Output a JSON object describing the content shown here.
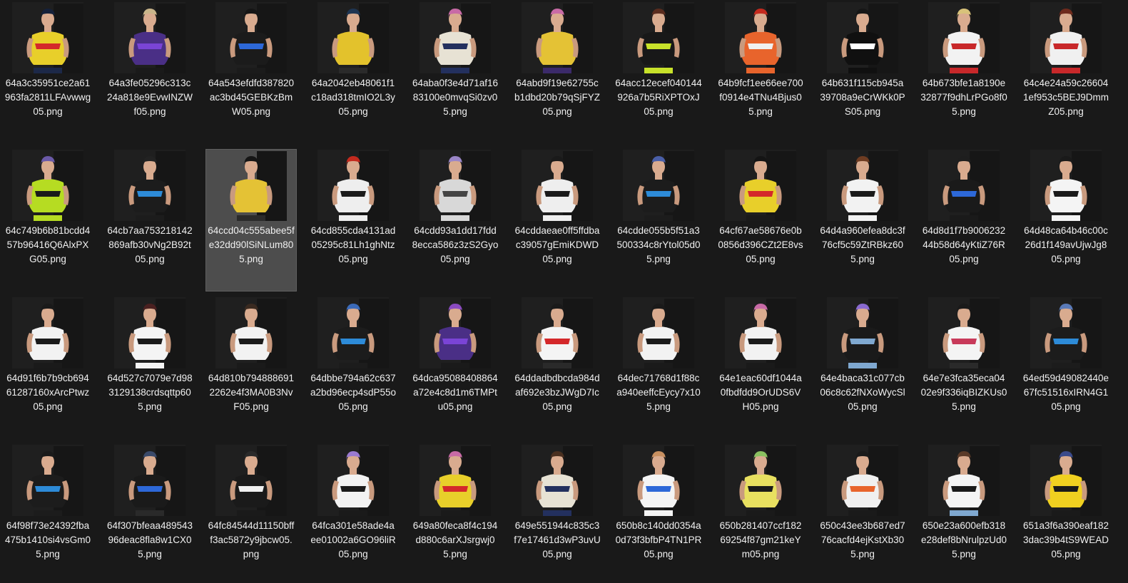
{
  "window": {
    "view": "large-icons",
    "background": "#191919"
  },
  "selected_index": 13,
  "files": [
    {
      "name": "64a3c35951ce2a61963fa2811LFAvwwg05.png",
      "hair": "#15213a",
      "top": "#e8cf2a",
      "accent": "#d4282a",
      "bottom": "#1c2848"
    },
    {
      "name": "64a3fe05296c313c24a818e9EvwINZWf05.png",
      "hair": "#c9b58a",
      "top": "#4a2f86",
      "accent": "#7a44d6",
      "bottom": "#1a1a1a"
    },
    {
      "name": "64a543efdfd387820ac3bd45GEBKzBmW05.png",
      "hair": "#151515",
      "top": "#1b1b1b",
      "accent": "#2d68d8",
      "bottom": "#1b1b1b"
    },
    {
      "name": "64a2042eb48061f1c18ad318tmIO2L3y05.png",
      "hair": "#1e3552",
      "top": "#e3c22c",
      "accent": "#e3c22c",
      "bottom": "#2a2a2a"
    },
    {
      "name": "64aba0f3e4d71af1683100e0mvqSi0zv05.png",
      "hair": "#c86aa6",
      "top": "#e7e2d4",
      "accent": "#23305e",
      "bottom": "#23305e"
    },
    {
      "name": "64abd9f19e62755cb1dbd20b79qSjFYZ05.png",
      "hair": "#c86aa6",
      "top": "#e4c235",
      "accent": "#e4c235",
      "bottom": "#3b2a6a"
    },
    {
      "name": "64acc12ecef040144926a7b5RiXPTOxJ05.png",
      "hair": "#5a2c1e",
      "top": "#181818",
      "accent": "#c8e22a",
      "bottom": "#c8e22a"
    },
    {
      "name": "64b9fcf1ee66ee700f0914e4TNu4Bjus05.png",
      "hair": "#c42a1e",
      "top": "#e8642c",
      "accent": "#f0f0f0",
      "bottom": "#e8642c"
    },
    {
      "name": "64b631f115cb945a39708a9eCrWKk0PS05.png",
      "hair": "#161616",
      "top": "#101010",
      "accent": "#ffffff",
      "bottom": "#101010"
    },
    {
      "name": "64b673bfe1a8190e32877f9dhLrPGo8f05.png",
      "hair": "#d8c27a",
      "top": "#f2f2f2",
      "accent": "#c8282a",
      "bottom": "#c8282a"
    },
    {
      "name": "64c4e24a59c266041ef953c5BEJ9DmmZ05.png",
      "hair": "#6e2a1c",
      "top": "#f0f0f0",
      "accent": "#c8282a",
      "bottom": "#c8282a"
    },
    {
      "name": "64c749b6b81bcdd457b96416Q6AlxPXG05.png",
      "hair": "#6b5aa8",
      "top": "#b6dc22",
      "accent": "#1a1a1a",
      "bottom": "#b6dc22"
    },
    {
      "name": "64cb7aa753218142869afb30vNg2B92t05.png",
      "hair": "#222222",
      "top": "#1c1c1c",
      "accent": "#2d8bd8",
      "bottom": "#1c1c1c"
    },
    {
      "name": "64ccd04c555abee5fe32dd90lSiNLum805.png",
      "hair": "#161616",
      "top": "#e4c235",
      "accent": "#e4c235",
      "bottom": "#2a2a2a"
    },
    {
      "name": "64cd855cda4131ad05295c81Lh1ghNtz05.png",
      "hair": "#c42a1e",
      "top": "#eeeeee",
      "accent": "#1a1a1a",
      "bottom": "#eeeeee"
    },
    {
      "name": "64cdd93a1dd17fdd8ecca586z3zS2Gyo05.png",
      "hair": "#9b86c8",
      "top": "#d8d8d8",
      "accent": "#444444",
      "bottom": "#d8d8d8"
    },
    {
      "name": "64cddaeae0ff5ffdbac39057gEmiKDWD05.png",
      "hair": "#1a1a1a",
      "top": "#eeeeee",
      "accent": "#1a1a1a",
      "bottom": "#eeeeee"
    },
    {
      "name": "64cdde055b5f51a3500334c8rYtol05d05.png",
      "hair": "#4a5fa8",
      "top": "#1c1c1c",
      "accent": "#2d8bd8",
      "bottom": "#1c1c1c"
    },
    {
      "name": "64cf67ae58676e0b0856d396CZt2E8vs05.png",
      "hair": "#141414",
      "top": "#e8cf2a",
      "accent": "#d4282a",
      "bottom": "#1a1a1a"
    },
    {
      "name": "64d4a960efea8dc3f76cf5c59ZtRBkz605.png",
      "hair": "#6e3c22",
      "top": "#f2f2f2",
      "accent": "#1a1a1a",
      "bottom": "#f2f2f2"
    },
    {
      "name": "64d8d1f7b900623244b58d64yKtiZ76R05.png",
      "hair": "#1e1e1e",
      "top": "#1a1a1a",
      "accent": "#2d68d8",
      "bottom": "#1a1a1a"
    },
    {
      "name": "64d48ca64b46c00c26d1f149avUjwJg805.png",
      "hair": "#1a1a1a",
      "top": "#f4f4f4",
      "accent": "#1a1a1a",
      "bottom": "#f4f4f4"
    },
    {
      "name": "64d91f6b7b9cb69461287160xArcPtwz05.png",
      "hair": "#1a1a1a",
      "top": "#f2f2f2",
      "accent": "#1a1a1a",
      "bottom": "#1a1a1a"
    },
    {
      "name": "64d527c7079e7d983129138crdsqttp605.png",
      "hair": "#4a2020",
      "top": "#f4f4f4",
      "accent": "#1a1a1a",
      "bottom": "#f4f4f4"
    },
    {
      "name": "64d810b7948886912262e4f3MA0B3NvF05.png",
      "hair": "#3a2a20",
      "top": "#f2f2f2",
      "accent": "#1a1a1a",
      "bottom": "#1a1a1a"
    },
    {
      "name": "64dbbe794a62c637a2bd96ecp4sdP55o05.png",
      "hair": "#3b6ab8",
      "top": "#1c1c1c",
      "accent": "#2d8bd8",
      "bottom": "#1c1c1c"
    },
    {
      "name": "64dca95088408864a72e4c8d1m6TMPtu05.png",
      "hair": "#8a4ac0",
      "top": "#4a2f86",
      "accent": "#7a44d6",
      "bottom": "#1a1a1a"
    },
    {
      "name": "64ddadbdbcda984daf692e3bzJWgD7Ic05.png",
      "hair": "#1a1a1a",
      "top": "#f4f4f4",
      "accent": "#d4282a",
      "bottom": "#2a2a2a"
    },
    {
      "name": "64dec71768d1f88ca940eeffcEycy7x105.png",
      "hair": "#1a1a1a",
      "top": "#f2f2f2",
      "accent": "#1a1a1a",
      "bottom": "#1a1a1a"
    },
    {
      "name": "64e1eac60df1044a0fbdfdd9OrUDS6VH05.png",
      "hair": "#c86aa6",
      "top": "#f2f2f2",
      "accent": "#1a1a1a",
      "bottom": "#1a1a1a"
    },
    {
      "name": "64e4baca31c077cb06c8c62fNXoWycSl05.png",
      "hair": "#8a6ad0",
      "top": "#1a1a1a",
      "accent": "#7fa8d0",
      "bottom": "#7fa8d0"
    },
    {
      "name": "64e7e3fca35eca0402e9f336iqBIZKUs05.png",
      "hair": "#1a1a1a",
      "top": "#f4f4f4",
      "accent": "#c83a5a",
      "bottom": "#2a2a2a"
    },
    {
      "name": "64ed59d49082440e67fc51516xIRN4G105.png",
      "hair": "#5a7ab8",
      "top": "#1c1c1c",
      "accent": "#2d8bd8",
      "bottom": "#1c1c1c"
    },
    {
      "name": "64f98f73e24392fba475b1410si4vsGm05.png",
      "hair": "#1a1a1a",
      "top": "#1c1c1c",
      "accent": "#2d8bd8",
      "bottom": "#1c1c1c"
    },
    {
      "name": "64f307bfeaa48954396deac8fla8w1CX05.png",
      "hair": "#3a4a6a",
      "top": "#1a1a1a",
      "accent": "#2d68d8",
      "bottom": "#2a2a2a"
    },
    {
      "name": "64fc84544d11150bfff3ac5872y9jbcw05.png",
      "hair": "#2a2a2a",
      "top": "#1a1a1a",
      "accent": "#f0f0f0",
      "bottom": "#1a1a1a"
    },
    {
      "name": "64fca301e58ade4aee01002a6GO96liR05.png",
      "hair": "#9a7ad0",
      "top": "#f2f2f2",
      "accent": "#1a1a1a",
      "bottom": "#1a1a1a"
    },
    {
      "name": "649a80feca8f4c194d880c6arXJsrgwj05.png",
      "hair": "#c86aa6",
      "top": "#e8cf2a",
      "accent": "#d4282a",
      "bottom": "#1a1a1a"
    },
    {
      "name": "649e551944c835c3f7e17461d3wP3uvU05.png",
      "hair": "#4a3020",
      "top": "#e7e2d4",
      "accent": "#23305e",
      "bottom": "#23305e"
    },
    {
      "name": "650b8c140dd0354a0d73f3bfbP4TN1PR05.png",
      "hair": "#c89060",
      "top": "#f4f4f4",
      "accent": "#2d68d8",
      "bottom": "#f4f4f4"
    },
    {
      "name": "650b281407ccf18269254f87gm21keYm05.png",
      "hair": "#8ac060",
      "top": "#e8e060",
      "accent": "#1a1a1a",
      "bottom": "#1a1a1a"
    },
    {
      "name": "650c43ee3b687ed776cacfd4ejKstXb305.png",
      "hair": "#1a1a1a",
      "top": "#f0f0f0",
      "accent": "#e8642c",
      "bottom": "#1a1a1a"
    },
    {
      "name": "650e23a600efb318e28def8bNrulpzUd05.png",
      "hair": "#5a3a28",
      "top": "#f4f4f4",
      "accent": "#1a1a1a",
      "bottom": "#7fa8d0"
    },
    {
      "name": "651a3f6a390eaf1823dac39b4tS9WEAD05.png",
      "hair": "#3a4a8a",
      "top": "#f0d020",
      "accent": "#1a1a1a",
      "bottom": "#1a1a1a"
    }
  ]
}
